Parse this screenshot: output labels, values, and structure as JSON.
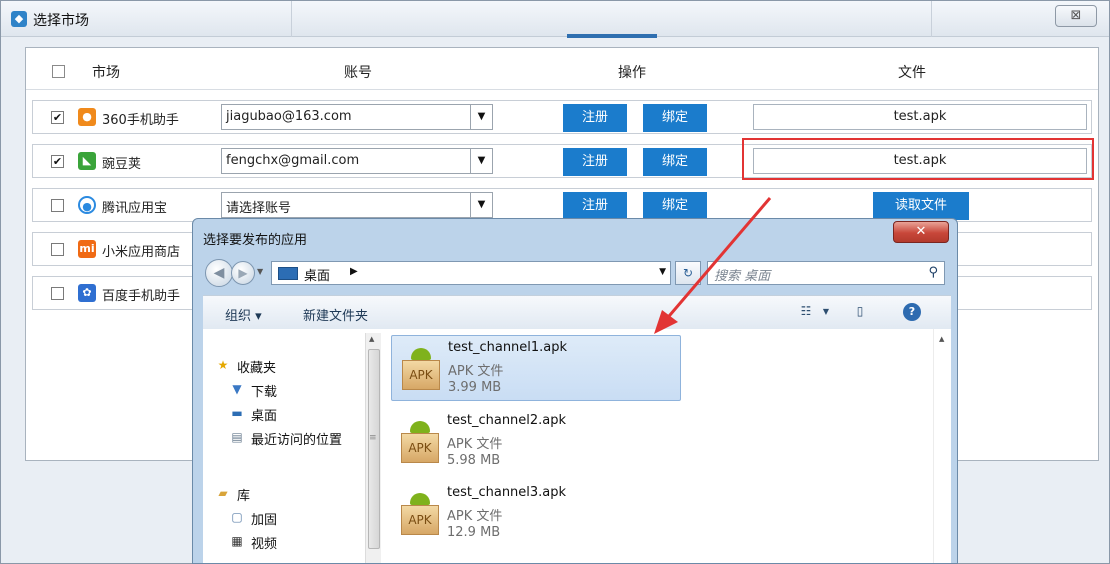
{
  "main": {
    "title": "选择市场",
    "close_glyph": "⊠",
    "headers": {
      "market": "市场",
      "account": "账号",
      "action": "操作",
      "file": "文件"
    },
    "rows": [
      {
        "checked": "✔",
        "icon": "360",
        "icon_color": "#f08a1c",
        "name": "360手机助手",
        "account": "jiagubao@163.com",
        "register": "注册",
        "bind": "绑定",
        "file": "test.apk"
      },
      {
        "checked": "✔",
        "icon": "W",
        "icon_color": "#3aa43a",
        "name": "豌豆荚",
        "account": "fengchx@gmail.com",
        "register": "注册",
        "bind": "绑定",
        "file": "test.apk"
      },
      {
        "checked": "",
        "icon": "Q",
        "icon_color": "#2b8ae0",
        "name": "腾讯应用宝",
        "account": "请选择账号",
        "register": "注册",
        "bind": "绑定",
        "file_button": "读取文件"
      },
      {
        "checked": "",
        "icon": "mi",
        "icon_color": "#f06a14",
        "name": "小米应用商店"
      },
      {
        "checked": "",
        "icon": "🐾",
        "icon_color": "#2f6fd1",
        "name": "百度手机助手"
      }
    ]
  },
  "dialog": {
    "title": "选择要发布的应用",
    "close_glyph": "✕",
    "path": "桌面",
    "search_placeholder": "搜索 桌面",
    "toolbar": {
      "organize": "组织 ▾",
      "new_folder": "新建文件夹"
    },
    "nav": {
      "favorites": "收藏夹",
      "downloads": "下载",
      "desktop": "桌面",
      "recent": "最近访问的位置",
      "libraries": "库",
      "jiagu": "加固",
      "videos": "视频"
    },
    "files": [
      {
        "name": "test_channel1.apk",
        "type": "APK 文件",
        "size": "3.99 MB",
        "icon_label": "APK"
      },
      {
        "name": "test_channel2.apk",
        "type": "APK 文件",
        "size": "5.98 MB",
        "icon_label": "APK"
      },
      {
        "name": "test_channel3.apk",
        "type": "APK 文件",
        "size": "12.9 MB",
        "icon_label": "APK"
      }
    ]
  },
  "colors": {
    "accent_blue": "#1b7ccc",
    "highlight_red": "#e23434",
    "arrow_red": "#e23434"
  }
}
